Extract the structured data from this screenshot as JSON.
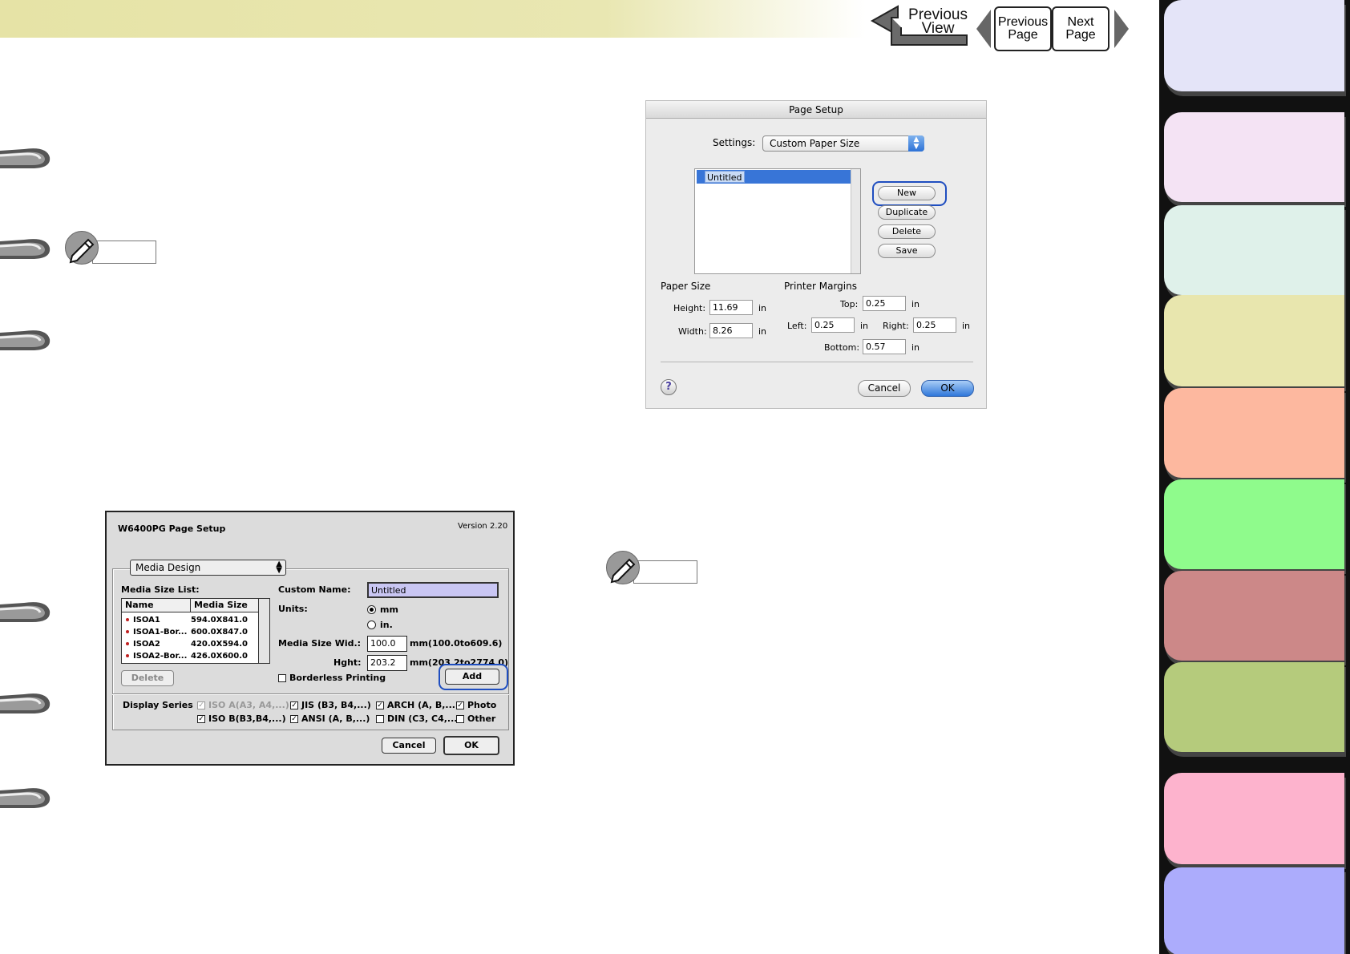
{
  "nav": {
    "previous_view": "Previous\nView",
    "previous_page": "Previous\nPage",
    "next_page": "Next\nPage"
  },
  "tab_colors": [
    "#e4e4f8",
    "#f4e3f4",
    "#dff1ea",
    "#e8e6ae",
    "#fdb89f",
    "#8ffb8c",
    "#cc8888",
    "#b5cb7c",
    "#fdb3cd",
    "#acacfc"
  ],
  "osx_dialog": {
    "title": "Page Setup",
    "settings_label": "Settings:",
    "settings_value": "Custom Paper Size",
    "list_items": [
      "Untitled"
    ],
    "buttons": {
      "new": "New",
      "duplicate": "Duplicate",
      "delete": "Delete",
      "save": "Save",
      "cancel": "Cancel",
      "ok": "OK"
    },
    "paper_size": {
      "heading": "Paper Size",
      "height_label": "Height:",
      "height_value": "11.69",
      "width_label": "Width:",
      "width_value": "8.26",
      "unit": "in"
    },
    "margins": {
      "heading": "Printer Margins",
      "top_label": "Top:",
      "top_value": "0.25",
      "left_label": "Left:",
      "left_value": "0.25",
      "right_label": "Right:",
      "right_value": "0.25",
      "bottom_label": "Bottom:",
      "bottom_value": "0.57",
      "unit": "in"
    },
    "help": "?"
  },
  "os9_dialog": {
    "title": "W6400PG Page Setup",
    "version": "Version 2.20",
    "popup_value": "Media Design",
    "media_size_list_label": "Media Size List:",
    "col_name": "Name",
    "col_size": "Media Size",
    "rows": [
      {
        "name": "ISOA1",
        "size": "594.0X841.0"
      },
      {
        "name": "ISOA1-Bor...",
        "size": "600.0X847.0"
      },
      {
        "name": "ISOA2",
        "size": "420.0X594.0"
      },
      {
        "name": "ISOA2-Bor...",
        "size": "426.0X600.0"
      }
    ],
    "delete_button": "Delete",
    "custom_name_label": "Custom Name:",
    "custom_name_value": "Untitled",
    "units_label": "Units:",
    "unit_mm": "mm",
    "unit_in": "in.",
    "width_label": "Media Size Wid.:",
    "width_value": "100.0",
    "width_range": "mm(100.0to609.6)",
    "height_label": "Hght:",
    "height_value": "203.2",
    "height_range": "mm(203.2to2774.0)",
    "borderless_label": "Borderless Printing",
    "add_button": "Add",
    "display_series_label": "Display Series",
    "series": {
      "iso_a": "ISO A(A3, A4,...)",
      "jis": "JIS (B3, B4,...)",
      "arch": "ARCH (A, B,...)",
      "photo": "Photo",
      "iso_b": "ISO B(B3,B4,...)",
      "ansi": "ANSI (A, B,...)",
      "din": "DIN (C3, C4,...)",
      "other": "Other"
    },
    "check_mark": "✓",
    "cancel_button": "Cancel",
    "ok_button": "OK"
  }
}
